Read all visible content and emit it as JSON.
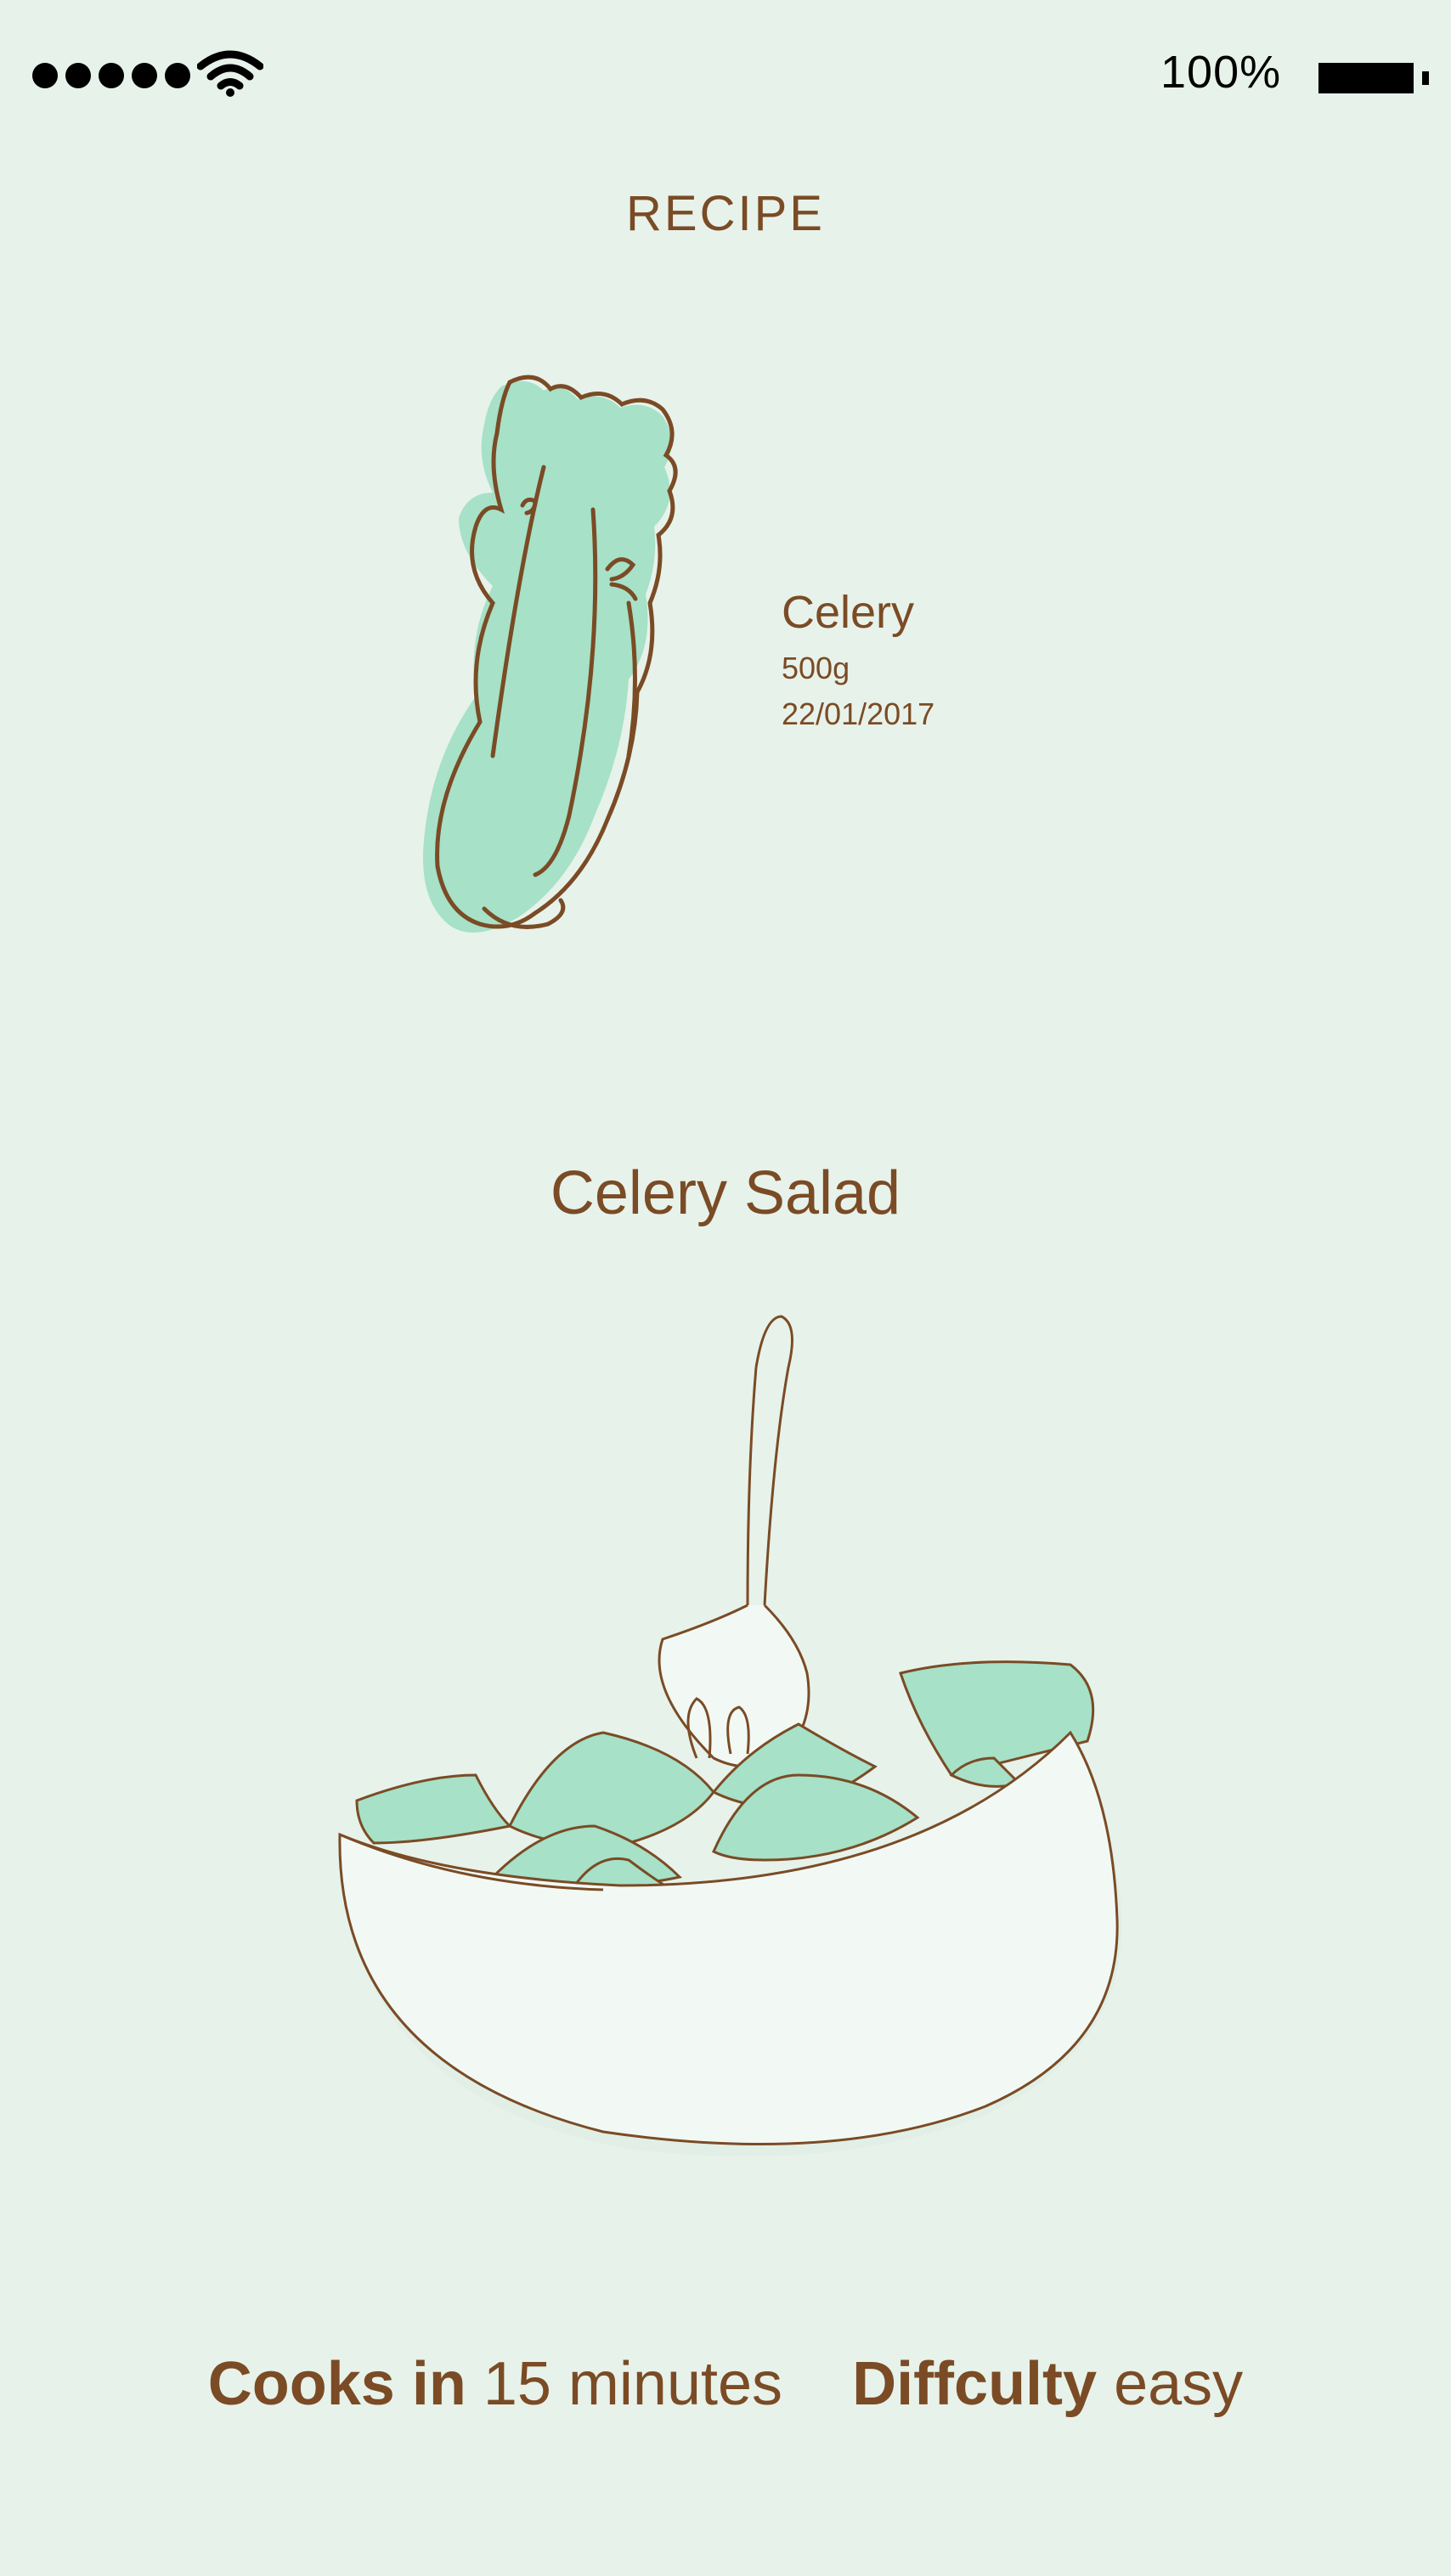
{
  "status_bar": {
    "signal_icon": "signal-dots-icon",
    "wifi_icon": "wifi-icon",
    "battery_percent": "100%",
    "battery_icon": "battery-full-icon"
  },
  "header": {
    "title": "RECIPE"
  },
  "ingredient": {
    "illustration": "celery-icon",
    "name": "Celery",
    "amount": "500g",
    "date": "22/01/2017"
  },
  "dish": {
    "title": "Celery Salad",
    "illustration": "salad-bowl-icon"
  },
  "cook_info": {
    "time_label": "Cooks in",
    "time_value": "15 minutes",
    "difficulty_label": "Diffculty",
    "difficulty_value": "easy"
  },
  "colors": {
    "background": "#e7f2ea",
    "text_brown": "#7a4b25",
    "mint": "#a6e1c8",
    "bowl_fill": "#f2f9f5"
  }
}
